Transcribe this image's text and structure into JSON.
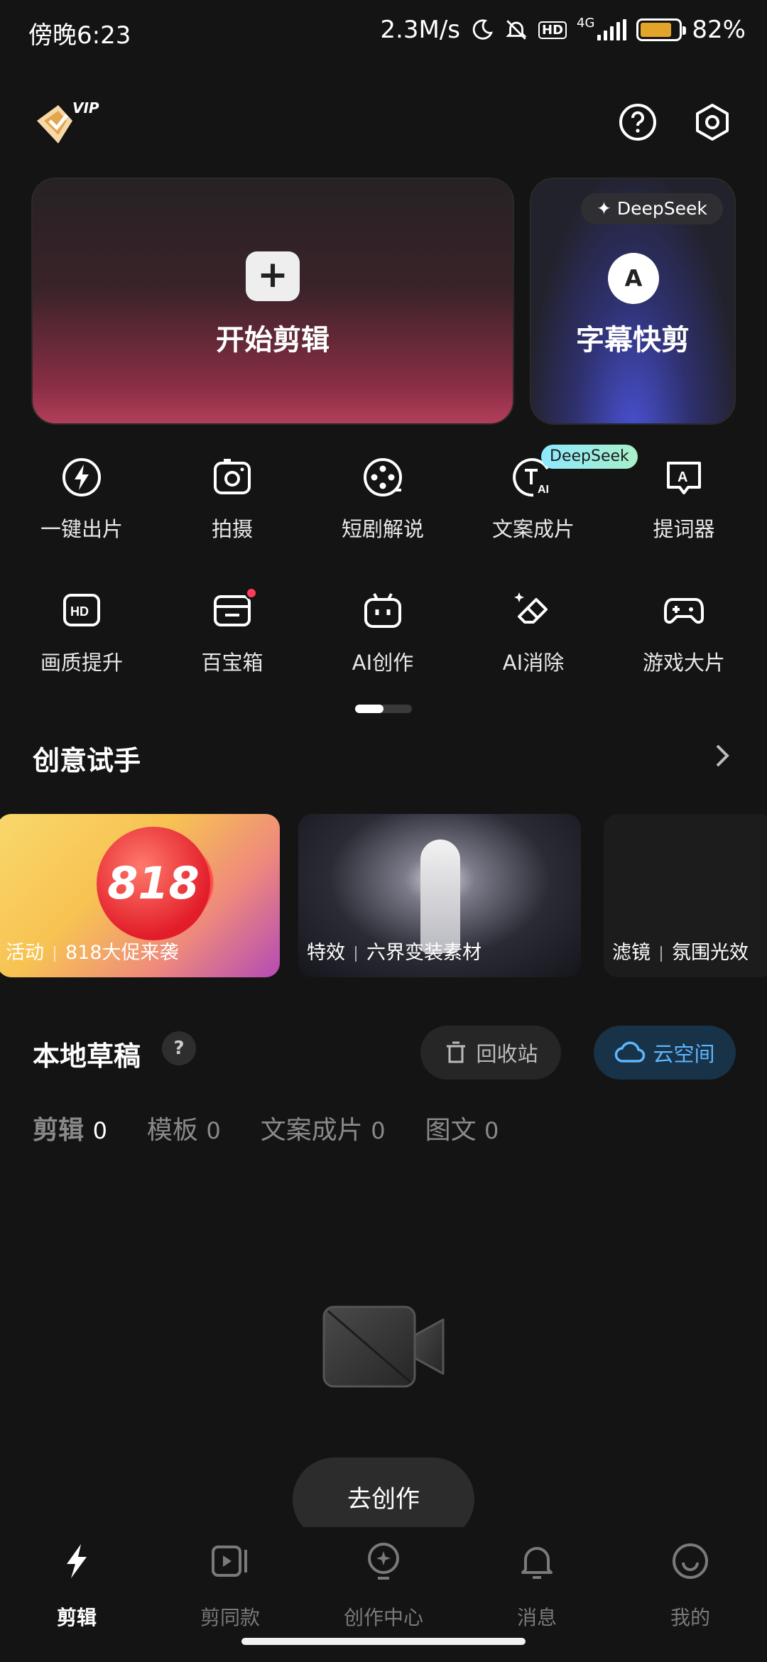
{
  "status_bar": {
    "time": "傍晚6:23",
    "net_speed": "2.3M/s",
    "hd": "HD",
    "network": "4G",
    "battery": "82%",
    "battery_level": 0.82
  },
  "header": {
    "vip": "VIP"
  },
  "cards": {
    "edit": {
      "plus": "+",
      "label": "开始剪辑"
    },
    "subtitle": {
      "badge": "DeepSeek",
      "letter": "A",
      "label": "字幕快剪"
    }
  },
  "tools_row1": [
    {
      "label": "一键出片",
      "icon": "lightning-icon"
    },
    {
      "label": "拍摄",
      "icon": "camera-icon"
    },
    {
      "label": "短剧解说",
      "icon": "film-reel-icon"
    },
    {
      "label": "文案成片",
      "icon": "text-ai-icon",
      "badge": "DeepSeek"
    },
    {
      "label": "提词器",
      "icon": "teleprompter-icon"
    }
  ],
  "tools_row2": [
    {
      "label": "画质提升",
      "icon": "hd-icon"
    },
    {
      "label": "百宝箱",
      "icon": "toolbox-icon"
    },
    {
      "label": "AI创作",
      "icon": "robot-icon"
    },
    {
      "label": "AI消除",
      "icon": "eraser-icon"
    },
    {
      "label": "游戏大片",
      "icon": "gamepad-icon"
    }
  ],
  "creative": {
    "title": "创意试手",
    "tiles": [
      {
        "tag": "活动",
        "text": "818大促来袭",
        "art": "818"
      },
      {
        "tag": "特效",
        "text": "六界变装素材"
      },
      {
        "tag": "滤镜",
        "text": "氛围光效"
      }
    ]
  },
  "drafts": {
    "title": "本地草稿",
    "help": "?",
    "recycle": "回收站",
    "cloud": "云空间",
    "tabs": [
      {
        "label": "剪辑",
        "count": "0"
      },
      {
        "label": "模板",
        "count": "0"
      },
      {
        "label": "文案成片",
        "count": "0"
      },
      {
        "label": "图文",
        "count": "0"
      }
    ],
    "go_create": "去创作"
  },
  "bottom_nav": [
    {
      "label": "剪辑",
      "icon": "scissors-bolt-icon"
    },
    {
      "label": "剪同款",
      "icon": "template-video-icon"
    },
    {
      "label": "创作中心",
      "icon": "bulb-icon"
    },
    {
      "label": "消息",
      "icon": "bell-icon"
    },
    {
      "label": "我的",
      "icon": "profile-smile-icon"
    }
  ]
}
